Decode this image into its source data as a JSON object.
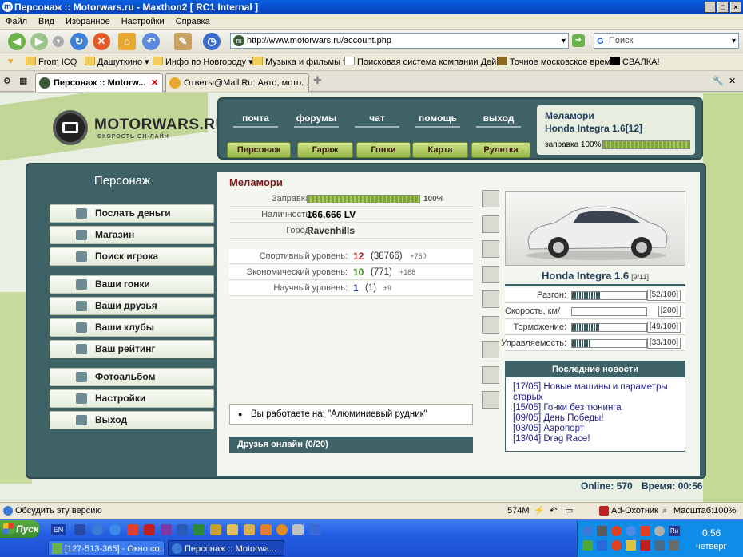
{
  "window": {
    "title": "Персонаж :: Motorwars.ru - Maxthon2 [ RC1 Internal ]"
  },
  "menu": [
    "Файл",
    "Вид",
    "Избранное",
    "Настройки",
    "Справка"
  ],
  "address": {
    "url": "http://www.motorwars.ru/account.php",
    "search_placeholder": "Поиск"
  },
  "favorites": [
    "From ICQ",
    "Дашуткино",
    "Инфо по Новгороду",
    "Музыка и фильмы",
    "Поисковая система компании Дей...",
    "Точное московское время",
    "СВАЛКА!"
  ],
  "tabs": [
    {
      "label": "Персонаж :: Motorw...",
      "active": true
    },
    {
      "label": "Ответы@Mail.Ru: Авто, мото. ...",
      "active": false
    }
  ],
  "site": {
    "logo": "MOTORWARS.RU",
    "slogan": "СКОРОСТЬ ОН-ЛАЙН",
    "top_nav": [
      "почта",
      "форумы",
      "чат",
      "помощь",
      "выход"
    ],
    "nav_buttons": [
      "Персонаж",
      "Гараж",
      "Гонки",
      "Карта",
      "Рулетка"
    ],
    "user": {
      "name": "Меламори",
      "car": "Honda Integra 1.6[12]",
      "fuel_label": "заправка 100%",
      "fuel": 100
    },
    "section_title": "Персонаж",
    "sidebar": [
      {
        "label": "Послать деньги",
        "icon": "money-icon"
      },
      {
        "label": "Магазин",
        "icon": "shop-icon"
      },
      {
        "label": "Поиск игрока",
        "icon": "magnifier-icon"
      },
      {
        "label": "Ваши гонки",
        "icon": "steering-wheel-icon"
      },
      {
        "label": "Ваши друзья",
        "icon": "friends-icon"
      },
      {
        "label": "Ваши клубы",
        "icon": "clubs-icon"
      },
      {
        "label": "Ваш рейтинг",
        "icon": "rating-icon"
      },
      {
        "label": "Фотоальбом",
        "icon": "camera-icon"
      },
      {
        "label": "Настройки",
        "icon": "settings-icon"
      },
      {
        "label": "Выход",
        "icon": "exit-icon"
      }
    ],
    "character": {
      "name": "Меламори",
      "fuel": {
        "label": "Заправка:",
        "value": "100%",
        "fill": 100
      },
      "cash": {
        "label": "Наличность:",
        "value": "166,666 LV"
      },
      "city": {
        "label": "Город:",
        "value": "Ravenhills"
      },
      "levels": [
        {
          "label": "Спортивный уровень:",
          "level": "12",
          "points": "(38766)",
          "delta": "+750",
          "color": "#b02020"
        },
        {
          "label": "Экономический уровень:",
          "level": "10",
          "points": "(771)",
          "delta": "+188",
          "color": "#3a8a1a"
        },
        {
          "label": "Научный уровень:",
          "level": "1",
          "points": "(1)",
          "delta": "+9",
          "color": "#1a2a8a"
        }
      ],
      "job": "Вы работаете на: \"Алюминиевый рудник\"",
      "friends": "Друзья онлайн (0/20)"
    },
    "car": {
      "name": "Honda Integra 1.6",
      "count": "[9/11]",
      "stats": [
        {
          "label": "Разгон:",
          "value": "[52/100]",
          "fill": 52
        },
        {
          "label": "Скорость, км/ч:",
          "value": "[200]",
          "fill": 0
        },
        {
          "label": "Торможение:",
          "value": "[49/100]",
          "fill": 49
        },
        {
          "label": "Управляемость:",
          "value": "[33/100]",
          "fill": 33
        }
      ]
    },
    "news": {
      "title": "Последние новости",
      "items": [
        "[17/05] Новые машины и параметры",
        "старых",
        "[15/05] Гонки без тюнинга",
        "[09/05] День Победы!",
        "[03/05] Аэропорт",
        "[13/04] Drag Race!"
      ]
    },
    "online": "Online: 570",
    "time": "Время: 00:56"
  },
  "status": {
    "left": "Обсудить эту версию",
    "memory": "574M",
    "adblock": "Ad-Охотник",
    "zoom": "Масштаб:100%"
  },
  "taskbar": {
    "start": "Пуск",
    "lang": "EN",
    "tasks": [
      "[127-513-365] - Окно со...",
      "Персонаж :: Motorwa..."
    ],
    "clock": "0:56",
    "day": "четверг"
  }
}
